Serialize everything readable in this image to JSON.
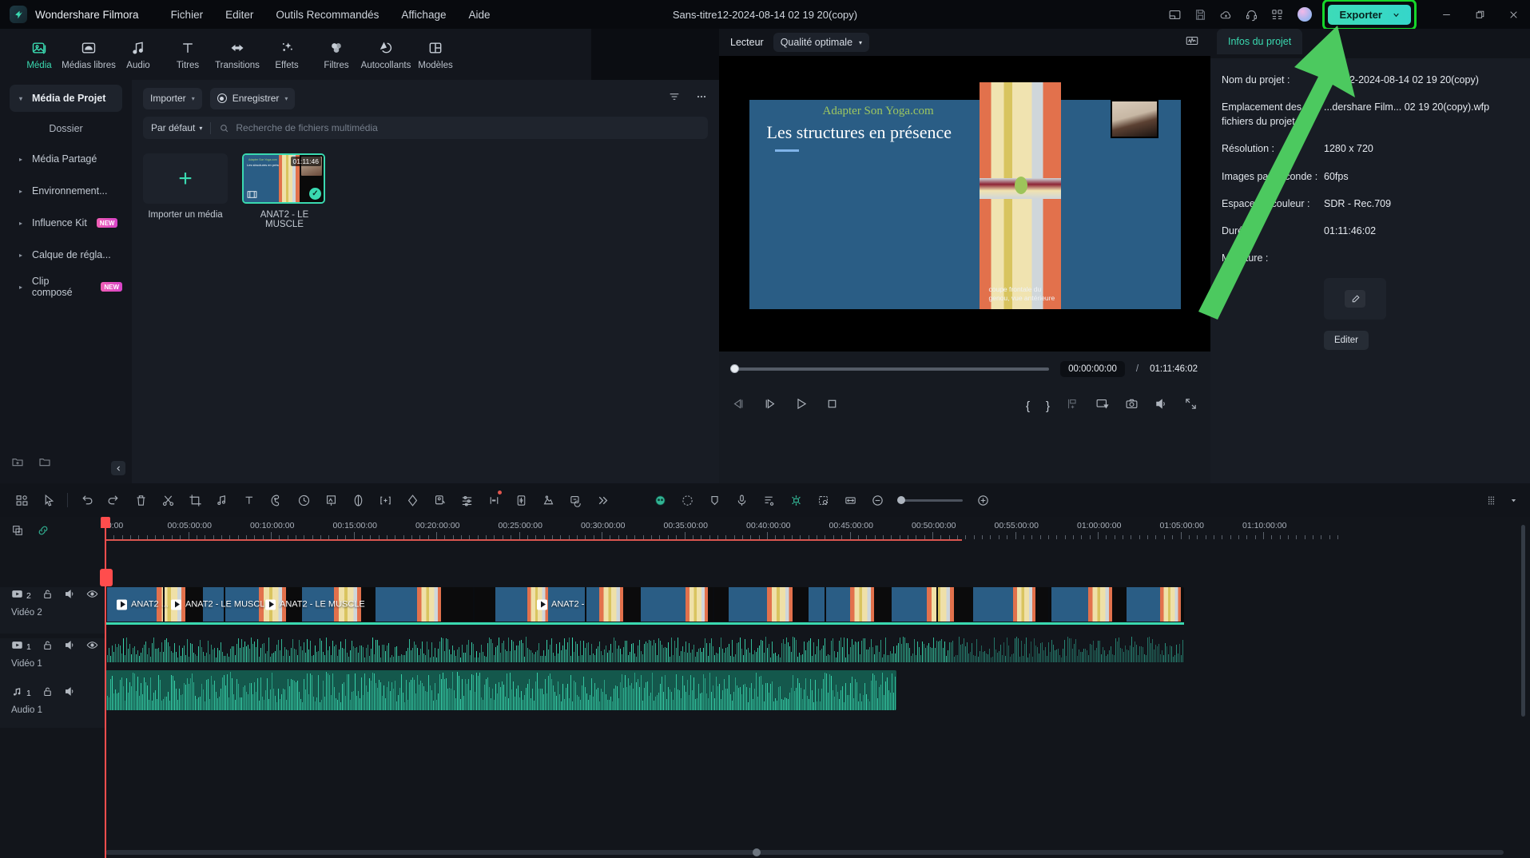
{
  "app": {
    "name": "Wondershare Filmora",
    "document_title": "Sans-titre12-2024-08-14 02 19 20(copy)"
  },
  "menubar": [
    "Fichier",
    "Editer",
    "Outils Recommandés",
    "Affichage",
    "Aide"
  ],
  "titlebar_right": {
    "icons": [
      "layout-icon",
      "save-icon",
      "cloud-upload-icon",
      "headset-support-icon",
      "apps-grid-icon"
    ],
    "avatar": "user-avatar",
    "export_label": "Exporter",
    "export_accent": "#3ddbb8",
    "highlight_color": "#16d62a",
    "window_buttons": [
      "minimize",
      "restore",
      "close"
    ]
  },
  "navtabs": [
    {
      "label": "Média",
      "icon": "media-icon",
      "active": true
    },
    {
      "label": "Médias libres",
      "icon": "stock-media-icon",
      "active": false
    },
    {
      "label": "Audio",
      "icon": "audio-note-icon",
      "active": false
    },
    {
      "label": "Titres",
      "icon": "title-text-icon",
      "active": false
    },
    {
      "label": "Transitions",
      "icon": "transitions-icon",
      "active": false
    },
    {
      "label": "Effets",
      "icon": "effects-wand-icon",
      "active": false
    },
    {
      "label": "Filtres",
      "icon": "filters-circles-icon",
      "active": false
    },
    {
      "label": "Autocollants",
      "icon": "stickers-icon",
      "active": false
    },
    {
      "label": "Modèles",
      "icon": "templates-grid-icon",
      "active": false
    }
  ],
  "sidebar": {
    "items": [
      {
        "label": "Média de Projet",
        "selected": true,
        "caret": "▾",
        "badge": null
      },
      {
        "label": "Dossier",
        "selected": false,
        "caret": "",
        "badge": null,
        "sub": true
      },
      {
        "label": "Média Partagé",
        "selected": false,
        "caret": "▸",
        "badge": null
      },
      {
        "label": "Environnement...",
        "selected": false,
        "caret": "▸",
        "badge": null
      },
      {
        "label": "Influence Kit",
        "selected": false,
        "caret": "▸",
        "badge": "NEW"
      },
      {
        "label": "Calque de régla...",
        "selected": false,
        "caret": "▸",
        "badge": null
      },
      {
        "label": "Clip composé",
        "selected": false,
        "caret": "▸",
        "badge": "NEW"
      }
    ],
    "bottom_icons": [
      "new-folder-icon",
      "folder-icon"
    ],
    "collapse_icon": "chevron-left-icon"
  },
  "media_panel": {
    "import_label": "Importer",
    "record_label": "Enregistrer",
    "filter_icon": "filter-icon",
    "more_icon": "more-horizontal-icon",
    "sort_label": "Par défaut",
    "search_placeholder": "Recherche de fichiers multimédia",
    "import_tile_label": "Importer un média",
    "items": [
      {
        "name": "ANAT2 - LE MUSCLE",
        "duration": "01:11:46",
        "selected": true,
        "slide_top_text": "Adapter Son Yoga.com",
        "slide_title": "Les structures en présence"
      }
    ]
  },
  "player": {
    "tab_label": "Lecteur",
    "quality_label": "Qualité optimale",
    "audio_meter_icon": "waveform-icon",
    "current_time": "00:00:00:00",
    "separator": "/",
    "total_time": "01:11:46:02",
    "slide": {
      "brand": "Adapter Son Yoga.com",
      "title": "Les structures en présence",
      "caption_line1": "coupe frontale du",
      "caption_line2": "genou, vue antérieure",
      "bg_color": "#2a5d85",
      "brand_color": "#9ec760"
    },
    "controls": [
      {
        "name": "previous-frame-button",
        "glyph": "prev-frame-icon"
      },
      {
        "name": "step-frame-button",
        "glyph": "next-frame-icon"
      },
      {
        "name": "play-button",
        "glyph": "play-icon"
      },
      {
        "name": "stop-button",
        "glyph": "stop-icon"
      }
    ],
    "right_controls": [
      {
        "name": "mark-in-button",
        "label": "{"
      },
      {
        "name": "mark-out-button",
        "label": "}"
      },
      {
        "name": "add-marker-button",
        "glyph": "marker-icon"
      },
      {
        "name": "screen-mode-button",
        "glyph": "monitor-icon"
      },
      {
        "name": "snapshot-button",
        "glyph": "camera-icon"
      },
      {
        "name": "volume-button",
        "glyph": "speaker-icon"
      },
      {
        "name": "fullscreen-button",
        "glyph": "fullscreen-icon"
      }
    ]
  },
  "right_panel": {
    "tab_label": "Infos du projet",
    "tab_color": "#3ad9b0",
    "fields": [
      {
        "key": "Nom du projet :",
        "value": "...tre12-2024-08-14 02 19 20(copy)"
      },
      {
        "key": "Emplacement des fichiers du projet :",
        "value": "...dershare Film... 02 19 20(copy).wfp"
      },
      {
        "key": "Résolution :",
        "value": "1280 x 720"
      },
      {
        "key": "Images par seconde :",
        "value": "60fps"
      },
      {
        "key": "Espace de couleur :",
        "value": "SDR - Rec.709"
      },
      {
        "key": "Durée :",
        "value": "01:11:46:02"
      },
      {
        "key": "Miniature :",
        "value": ""
      }
    ],
    "edit_button_label": "Editer",
    "thumbnail_icon": "edit-pencil-icon"
  },
  "timeline_toolbar": {
    "left_icons": [
      "grid-view-icon",
      "pointer-select-icon",
      "undo-icon",
      "redo-icon",
      "delete-icon",
      "split-scissors-icon",
      "crop-icon",
      "audio-detach-icon",
      "text-title-icon",
      "color-mask-icon",
      "speed-icon",
      "green-screen-icon",
      "stabilization-icon",
      "keyframe-icon",
      "mask-icon",
      "auto-reframe-icon",
      "audio-mixer-icon",
      "silence-detect-icon",
      "audio-beat-icon",
      "motion-tracking-icon",
      "auto-caption-icon",
      "more-chevrons-icon"
    ],
    "right_icons": [
      "ai-portrait-icon",
      "auto-highlight-icon",
      "marker-shield-icon",
      "voiceover-mic-icon",
      "subtitle-list-icon",
      "chroma-key-icon",
      "scene-detect-icon",
      "fit-timeline-icon",
      "zoom-out-icon",
      "zoom-in-icon",
      "track-manager-icon",
      "chevron-down-icon"
    ]
  },
  "timeline": {
    "head_icons": [
      "add-track-icon",
      "link-clips-icon"
    ],
    "ruler_labels": [
      "00:00",
      "00:05:00:00",
      "00:10:00:00",
      "00:15:00:00",
      "00:20:00:00",
      "00:25:00:00",
      "00:30:00:00",
      "00:35:00:00",
      "00:40:00:00",
      "00:45:00:00",
      "00:50:00:00",
      "00:55:00:00",
      "01:00:00:00",
      "01:05:00:00",
      "01:10:00:00"
    ],
    "tracks": [
      {
        "type": "video",
        "number": "2",
        "name": "Vidéo 2",
        "icons": [
          "video-track-icon",
          "lock-icon",
          "mute-icon",
          "eye-visible-icon"
        ],
        "clip_labels": [
          "ANAT2 ...",
          "ANAT2 - LE MUSCLE",
          "ANAT2 - LE MUSCLE",
          "ANAT2 - "
        ]
      },
      {
        "type": "video",
        "number": "1",
        "name": "Vidéo 1",
        "icons": [
          "video-track-icon",
          "lock-icon",
          "mute-icon",
          "eye-visible-icon"
        ],
        "clip_labels": []
      },
      {
        "type": "audio",
        "number": "1",
        "name": "Audio 1",
        "icons": [
          "audio-track-icon",
          "lock-icon",
          "mute-icon"
        ],
        "clip_labels": []
      }
    ]
  }
}
